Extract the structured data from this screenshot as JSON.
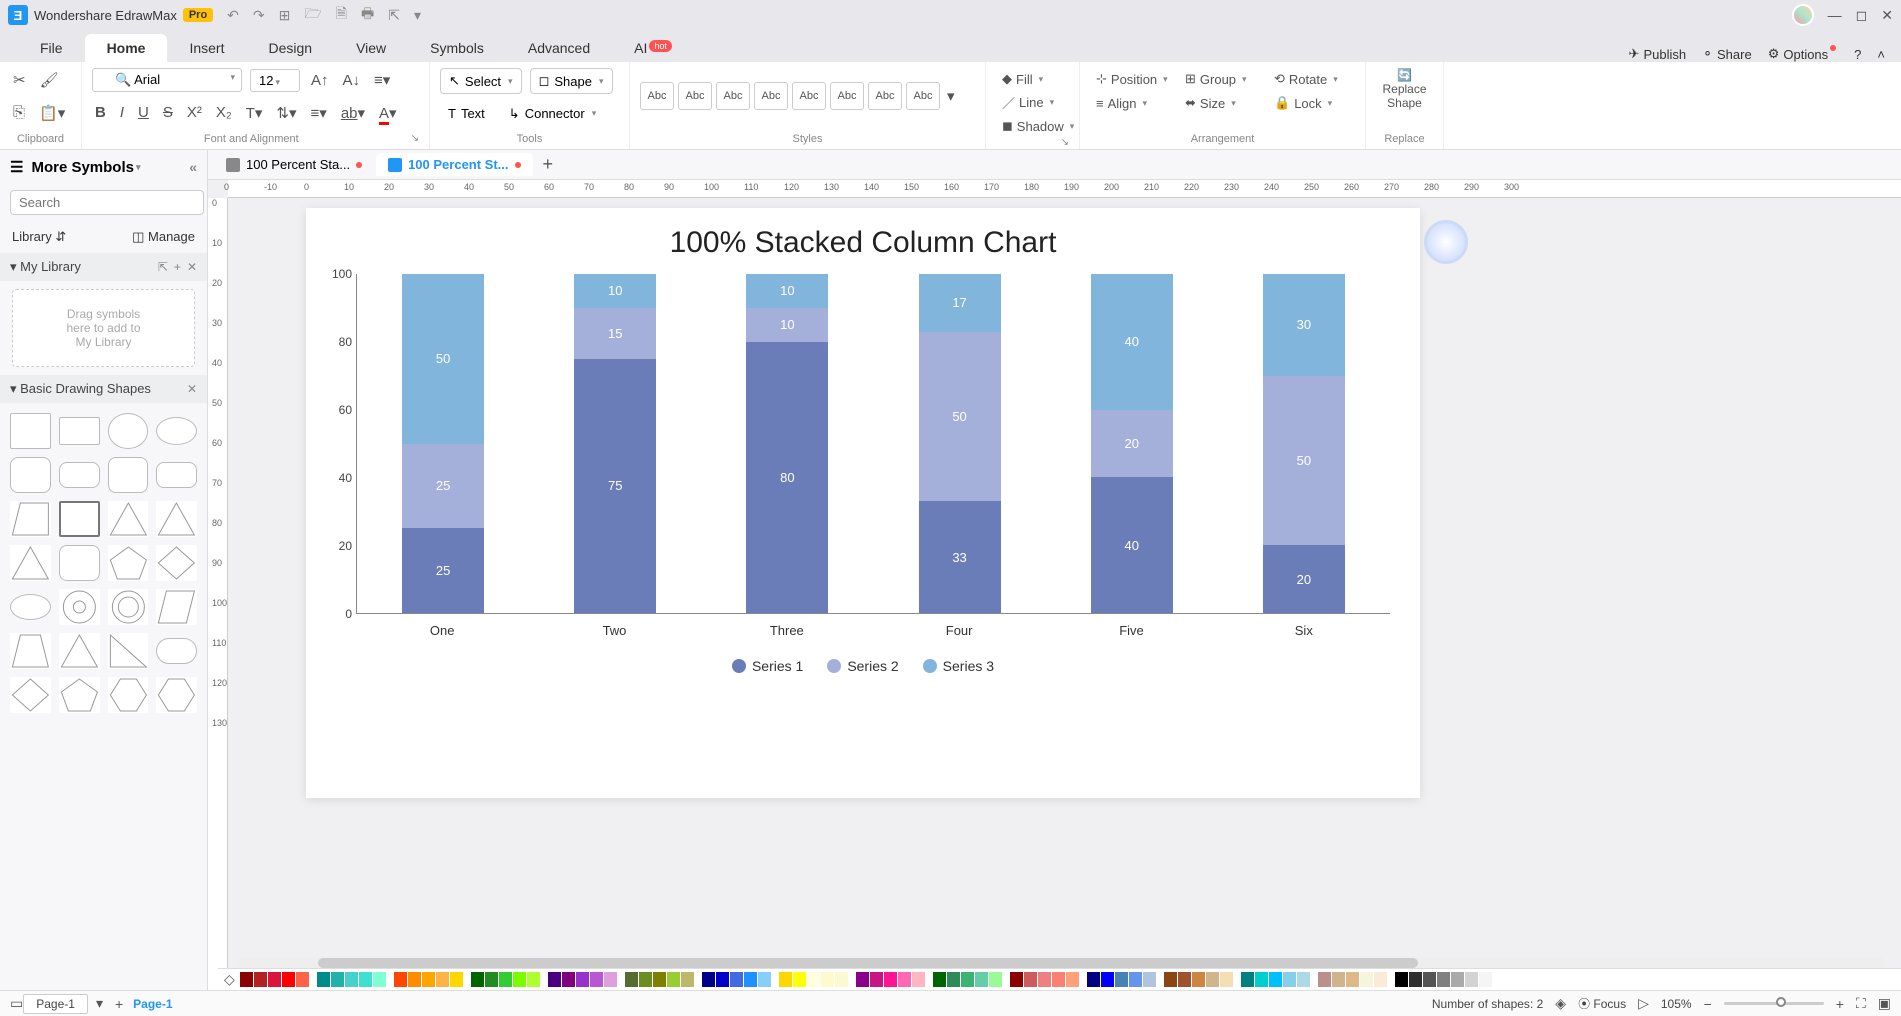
{
  "app": {
    "title": "Wondershare EdrawMax",
    "badge": "Pro"
  },
  "menu": {
    "tabs": [
      "File",
      "Home",
      "Insert",
      "Design",
      "View",
      "Symbols",
      "Advanced",
      "AI"
    ],
    "active": 1,
    "hot_index": 7,
    "right": {
      "publish": "Publish",
      "share": "Share",
      "options": "Options"
    }
  },
  "ribbon": {
    "font_name": "Arial",
    "font_size": "12",
    "groups": {
      "clipboard": "Clipboard",
      "font": "Font and Alignment",
      "tools": "Tools",
      "styles": "Styles",
      "arrangement": "Arrangement",
      "replace": "Replace"
    },
    "tools": {
      "select": "Select",
      "shape": "Shape",
      "text": "Text",
      "connector": "Connector"
    },
    "style_label": "Abc",
    "arr": {
      "fill": "Fill",
      "line": "Line",
      "shadow": "Shadow",
      "position": "Position",
      "align": "Align",
      "group": "Group",
      "size": "Size",
      "rotate": "Rotate",
      "lock": "Lock"
    },
    "replace_shape": "Replace\nShape"
  },
  "sidebar": {
    "title": "More Symbols",
    "search_placeholder": "Search",
    "search_btn": "Search",
    "library": "Library",
    "manage": "Manage",
    "mylib": "My Library",
    "mylib_hint": "Drag symbols\nhere to add to\nMy Library",
    "basic_shapes": "Basic Drawing Shapes"
  },
  "doctabs": {
    "tab1": "100 Percent Sta...",
    "tab2": "100 Percent St...",
    "active": 1
  },
  "ruler_h": [
    0,
    -10,
    0,
    10,
    20,
    30,
    40,
    50,
    60,
    70,
    80,
    90,
    100,
    110,
    120,
    130,
    140,
    150,
    160,
    170,
    180,
    190,
    200,
    210,
    220,
    230,
    240,
    250,
    260,
    270,
    280,
    290,
    300
  ],
  "ruler_v": [
    0,
    10,
    20,
    30,
    40,
    50,
    60,
    70,
    80,
    90,
    100,
    110,
    120,
    130
  ],
  "chart_data": {
    "type": "bar",
    "title": "100% Stacked Column Chart",
    "categories": [
      "One",
      "Two",
      "Three",
      "Four",
      "Five",
      "Six"
    ],
    "series": [
      {
        "name": "Series 1",
        "values": [
          25,
          75,
          80,
          33,
          40,
          20
        ],
        "color": "#6b7db8"
      },
      {
        "name": "Series 2",
        "values": [
          25,
          15,
          10,
          50,
          20,
          50
        ],
        "color": "#a4b0da"
      },
      {
        "name": "Series 3",
        "values": [
          50,
          10,
          10,
          17,
          40,
          30
        ],
        "color": "#82b5dc"
      }
    ],
    "ylim": [
      0,
      100
    ],
    "yticks": [
      0,
      20,
      40,
      60,
      80,
      100
    ]
  },
  "status": {
    "page_tab": "Page-1",
    "page_active": "Page-1",
    "shapes": "Number of shapes: 2",
    "focus": "Focus",
    "zoom": "105%"
  },
  "palette": [
    "#000",
    "#ec1c24",
    "#f15a24",
    "#f7931e",
    "#fbb03b",
    "#fcee21",
    "#d9e021",
    "#8cc63f",
    "#39b54a",
    "#009245",
    "#00a99d",
    "#29abe2",
    "#0071bc",
    "#2e3192",
    "#662d91",
    "#93278f",
    "#d4145a",
    "#ed1e79",
    "#c1272d",
    "#a67c52",
    "#8c6239",
    "#754c24",
    "#603813",
    "#42210b",
    "#ffffff",
    "#e6e6e6",
    "#cccccc",
    "#b3b3b3",
    "#999999",
    "#808080",
    "#666666",
    "#4d4d4d",
    "#333333",
    "#1a1a1a"
  ]
}
